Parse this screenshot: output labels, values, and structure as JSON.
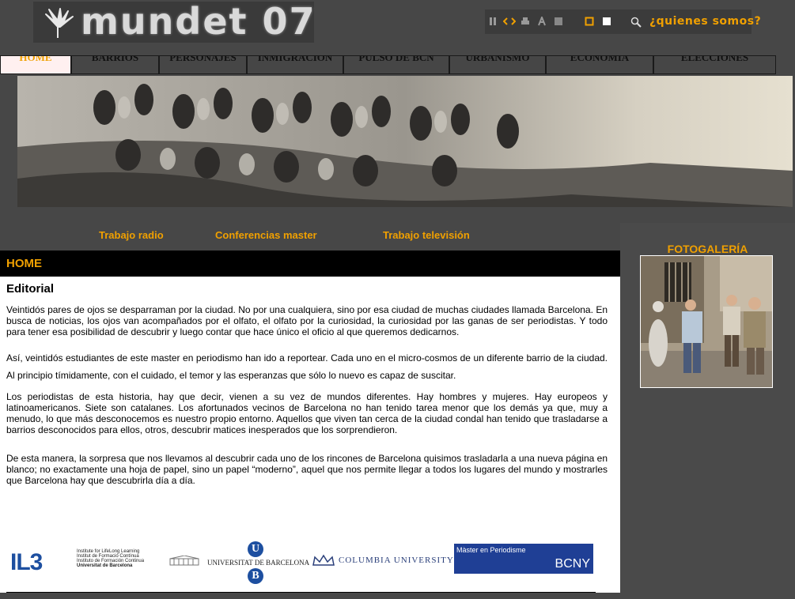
{
  "header": {
    "logo_text": "mundet 07",
    "about_link": "¿quienes somos?",
    "toolbar_icons": [
      "pause-icon",
      "code-icon",
      "print-icon",
      "font-icon",
      "stop-icon",
      "square-outline-icon",
      "square-icon",
      "search-icon"
    ]
  },
  "nav": {
    "items": [
      {
        "label": "HOME",
        "active": true
      },
      {
        "label": "BARRIOS"
      },
      {
        "label": "PERSONAJES"
      },
      {
        "label": "INMIGRACION"
      },
      {
        "label": "PULSO DE BCN"
      },
      {
        "label": "URBANISMO"
      },
      {
        "label": "ECONOMIA"
      },
      {
        "label": "ELECCIONES"
      }
    ]
  },
  "sublinks": [
    "Trabajo radio",
    "Conferencias master",
    "Trabajo televisión"
  ],
  "main": {
    "section_title": "HOME",
    "heading": "Editorial",
    "paragraphs": [
      "Veintidós pares de ojos se desparraman por la ciudad. No por una cualquiera, sino por esa ciudad de muchas ciudades llamada Barcelona. En busca de noticias, los ojos van acompañados por el olfato, el olfato por la curiosidad, la curiosidad por las ganas de ser periodistas. Y todo para tener esa posibilidad de descubrir y luego contar que hace único el oficio al que queremos dedicarnos.",
      "Así, veintidós estudiantes de este master en periodismo han ido a reportear. Cada uno en el micro-cosmos de un diferente barrio de la ciudad. Al principio tímidamente, con el cuidado, el temor y las esperanzas que sólo lo nuevo es capaz de suscitar.",
      "Los periodistas de esta historia, hay que decir, vienen a su vez de mundos diferentes. Hay hombres y mujeres. Hay europeos y latinoamericanos. Siete son catalanes. Los afortunados vecinos de Barcelona no han tenido tarea menor que los demás ya que, muy a menudo, lo que más desconocemos es nuestro propio entorno. Aquellos que viven tan cerca de la ciudad condal han tenido que trasladarse a barrios desconocidos para ellos, otros, descubrir matices inesperados que los sorprendieron.",
      "De esta manera, la sorpresa que nos llevamos al descubrir cada uno de los rincones de Barcelona quisimos trasladarla a una nueva página en blanco; no exactamente una hoja de papel, sino un papel “moderno”, aquel que nos permite llegar a todos los lugares del mundo y mostrarles que Barcelona hay que descubrirla día a día."
    ],
    "logos": {
      "il3": "IL3",
      "il3_lines": [
        "Institute for LifeLong Learning",
        "Institut de Formació Contínua",
        "Instituto de Formación Continua",
        "Universitat de Barcelona"
      ],
      "ub_letter": "U",
      "ub_name": "UNIVERSITAT DE BARCELONA",
      "ub_letter2": "B",
      "columbia": "COLUMBIA UNIVERSITY",
      "master_title": "Màster en Periodisme",
      "master_code": "BCNY"
    }
  },
  "sidebar": {
    "title": "FOTOGALERÍA"
  },
  "colors": {
    "accent": "#f0a000",
    "background": "#474747",
    "black": "#000000",
    "master_blue": "#1f3f95"
  }
}
